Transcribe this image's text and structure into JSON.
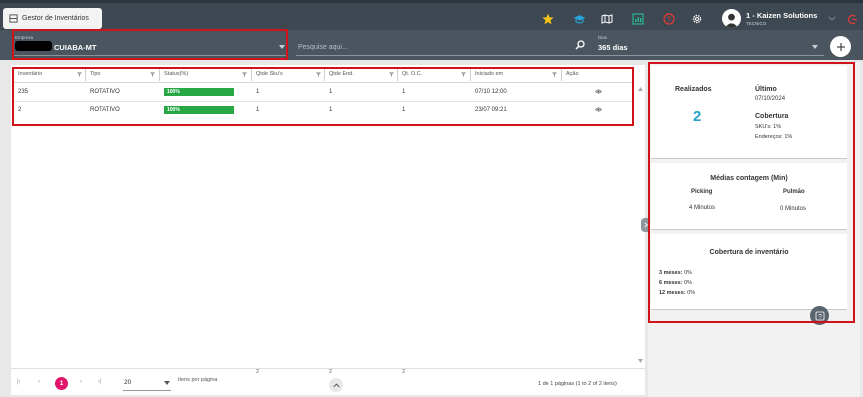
{
  "app_tab": {
    "label": "Gestor de Inventários"
  },
  "toolbar": {
    "icons": [
      "star-icon",
      "graduation-icon",
      "map-icon",
      "chart-icon",
      "help-circle-icon",
      "settings-icon",
      "logout-icon"
    ]
  },
  "user": {
    "name": "1 - Kaizen Solutions",
    "role": "TECNICO"
  },
  "filters": {
    "empresa_label": "Empresa",
    "empresa_value": "CUIABA-MT",
    "search_placeholder": "Pesquise aqui...",
    "dias_label": "Dias",
    "dias_value": "365 dias"
  },
  "table": {
    "columns": [
      "Inventário",
      "Tipo",
      "Status(%)",
      "Qtde Sku's",
      "Qtde End.",
      "Qt. O.C.",
      "Iniciado em",
      "Ação"
    ],
    "rows": [
      {
        "inventario": "235",
        "tipo": "ROTATIVO",
        "status": "100%",
        "qtde_skus": "1",
        "qtde_end": "1",
        "qt_oc": "1",
        "iniciado": "07/10 12:00"
      },
      {
        "inventario": "2",
        "tipo": "ROTATIVO",
        "status": "100%",
        "qtde_skus": "1",
        "qtde_end": "1",
        "qt_oc": "1",
        "iniciado": "23/07 09:21"
      }
    ],
    "status_progress": [
      1.0,
      1.0
    ],
    "totals": {
      "qtde_skus": "2",
      "qtde_end": "2",
      "qt_oc": "2"
    }
  },
  "pagination": {
    "current_page": "1",
    "page_size": "20",
    "page_size_label": "Itens por página",
    "summary": "1 de 1 páginas (1 to 2 of 2 itens)"
  },
  "stats": {
    "realizados_label": "Realizados",
    "realizados_value": "2",
    "ultimo_label": "Último",
    "ultimo_date": "07/10/2024",
    "cobertura_label": "Cobertura",
    "skus_cov": "SKU's: 1%",
    "enderecos_cov": "Endereços: 1%",
    "medias_title": "Médias contagem (Min)",
    "picking_label": "Picking",
    "pulmao_label": "Pulmão",
    "picking_value": "4 Minutos",
    "pulmao_value": "0 Minutos",
    "cobertura_title": "Cobertura de inventário",
    "cov_3m_label": "3 meses:",
    "cov_3m_value": "0%",
    "cov_6m_label": "6 meses:",
    "cov_6m_value": "0%",
    "cov_12m_label": "12 meses:",
    "cov_12m_value": "0%"
  },
  "colors": {
    "accent": "#2a9fc9",
    "status_green": "#28a745",
    "highlight": "#d0121b",
    "page_active": "#e0156b"
  }
}
